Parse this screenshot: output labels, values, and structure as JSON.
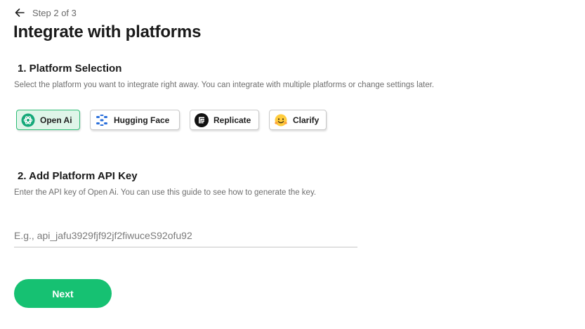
{
  "header": {
    "step_text": "Step 2 of 3",
    "title": "Integrate with platforms"
  },
  "section1": {
    "title": "1. Platform Selection",
    "description": "Select the platform you want to integrate right away. You can integrate with multiple platforms or change settings later."
  },
  "platforms": [
    {
      "label": "Open Ai",
      "icon": "openai-icon",
      "selected": true
    },
    {
      "label": "Hugging Face",
      "icon": "hugging-face-icon",
      "selected": false
    },
    {
      "label": "Replicate",
      "icon": "replicate-icon",
      "selected": false
    },
    {
      "label": "Clarify",
      "icon": "clarify-icon",
      "selected": false
    }
  ],
  "section2": {
    "title": "2. Add Platform API Key",
    "description": "Enter the API key of Open Ai. You can use this guide to see how to generate the key."
  },
  "api_key": {
    "value": "",
    "placeholder": "E.g., api_jafu3929fjf92jf2fiwuceS92ofu92"
  },
  "actions": {
    "next_label": "Next"
  },
  "colors": {
    "accent": "#16c172",
    "selected_bg": "#dff5e9",
    "selected_border": "#2ebd76"
  }
}
